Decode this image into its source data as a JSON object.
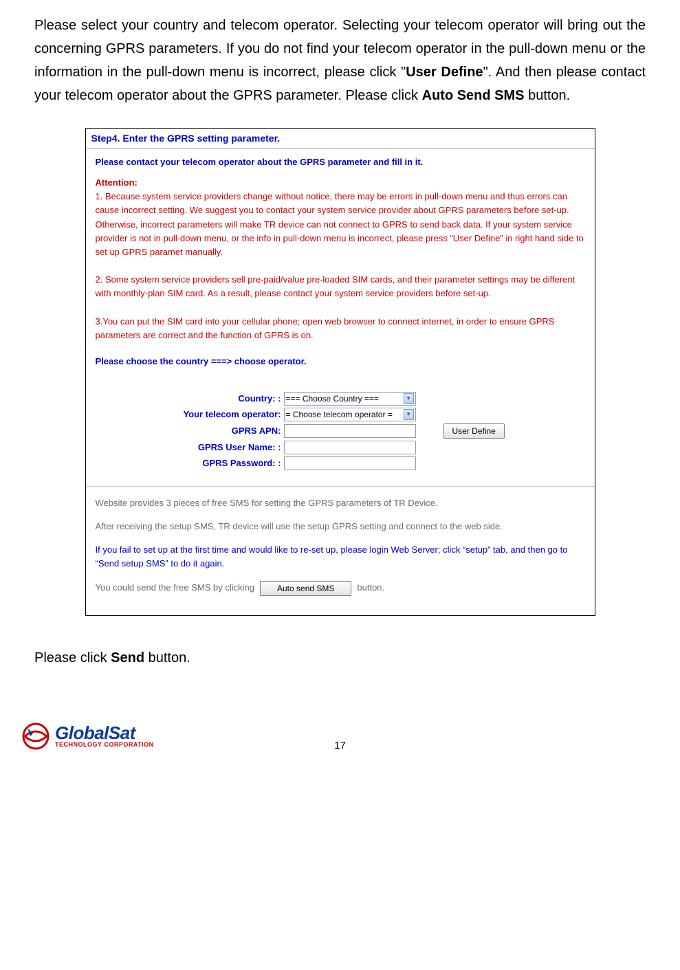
{
  "intro": {
    "p1a": "Please select your country and telecom operator. Selecting your telecom operator will bring out the concerning GPRS parameters. If you do not find your telecom operator in the pull-down menu or the information in the pull-down menu is incorrect, please click \"",
    "p1b": "User Define",
    "p1c": "\". And then please contact your telecom operator about the GPRS parameter. Please click ",
    "p1d": "Auto Send SMS",
    "p1e": " button."
  },
  "step_header": "Step4. Enter the GPRS setting parameter.",
  "top_blue": "Please contact your telecom operator about the GPRS parameter and fill in it.",
  "attention_title": "Attention:",
  "attention_1": "1. Because system service providers change without notice, there may be errors in pull-down menu and thus errors can cause incorrect setting. We suggest you to contact your system service provider about GPRS parameters before set-up. Otherwise, incorrect parameters will make TR device can not connect to GPRS to send back data. If your system service provider is not in pull-down menu, or the info in pull-down menu is incorrect, please press “User Define” in right hand side to set up GPRS paramet manually.",
  "attention_2": "2. Some system service providers sell pre-paid/value pre-loaded SIM cards, and their parameter settings may be different with monthly-plan SIM card. As a result, please contact your system service providers before set-up.",
  "attention_3": "3.You can put the SIM card into your cellular phone; open web browser to connect internet, in order to ensure GPRS parameters are correct and the function of GPRS is on.",
  "choose_line": "Please choose the country ===> choose operator.",
  "form": {
    "country_label": "Country: :",
    "country_value": "=== Choose Country ===",
    "operator_label": "Your telecom operator:",
    "operator_value": "= Choose telecom operator =",
    "apn_label": "GPRS APN:",
    "user_label": "GPRS User Name: :",
    "pass_label": "GPRS Password: :",
    "user_define_btn": "User Define"
  },
  "lower": {
    "l1": "Website provides 3 pieces of free SMS for setting the GPRS parameters of TR Device.",
    "l2": "After receiving the setup SMS, TR device will use the setup GPRS setting and connect to the web side.",
    "l3": "If you fail to set up at the first time and would like to re-set up, please login Web Server; click “setup” tab, and then go to “Send setup SMS” to do it again.",
    "l4a": "You could send the free SMS by clicking",
    "auto_send_btn": "Auto send SMS",
    "l4b": "button."
  },
  "post_text_a": "Please click ",
  "post_text_b": "Send",
  "post_text_c": " button.",
  "logo": {
    "brand": "GlobalSat",
    "sub": "TECHNOLOGY CORPORATION"
  },
  "page_number": "17"
}
